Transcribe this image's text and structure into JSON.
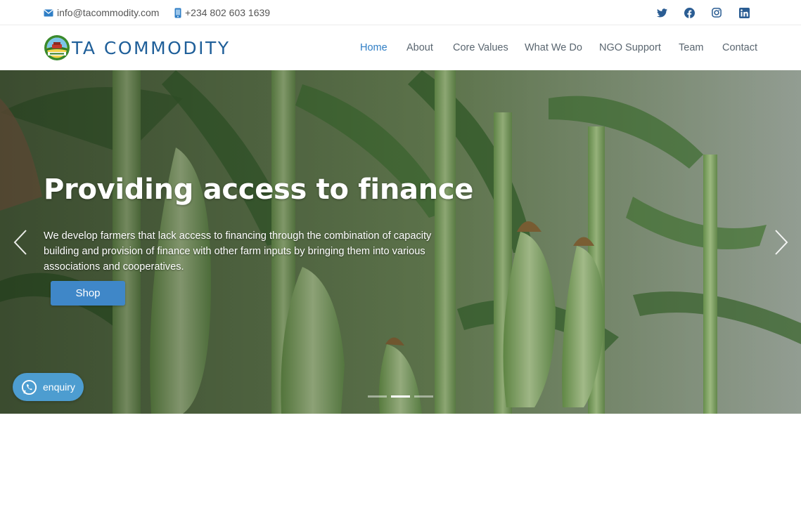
{
  "topbar": {
    "email": "info@tacommodity.com",
    "phone": "+234 802 603 1639",
    "email_icon": "envelope-icon",
    "phone_icon": "mobile-phone-icon",
    "social": [
      "twitter-icon",
      "facebook-icon",
      "instagram-icon",
      "linkedin-icon"
    ]
  },
  "header": {
    "logo_text": "TA COMMODITY",
    "nav": [
      "Home",
      "About",
      "Core Values",
      "What We Do",
      "NGO Support",
      "Team",
      "Contact"
    ],
    "active_nav": "Home"
  },
  "hero": {
    "title": "Providing access to finance",
    "text": "We develop farmers that lack access to financing through the combination of capacity building and provision of finance with other farm inputs by bringing them into various associations and cooperatives.",
    "button": "Shop",
    "slide_count": 3,
    "active_slide": 2,
    "prev_icon": "chevron-left-icon",
    "next_icon": "chevron-right-icon"
  },
  "enquiry": {
    "label": "enquiry",
    "icon": "whatsapp-icon"
  },
  "colors": {
    "brand": "#1f5f99",
    "accent": "#2f7ec5",
    "button": "#3f87c8",
    "enquiry": "#4d9dd0"
  }
}
